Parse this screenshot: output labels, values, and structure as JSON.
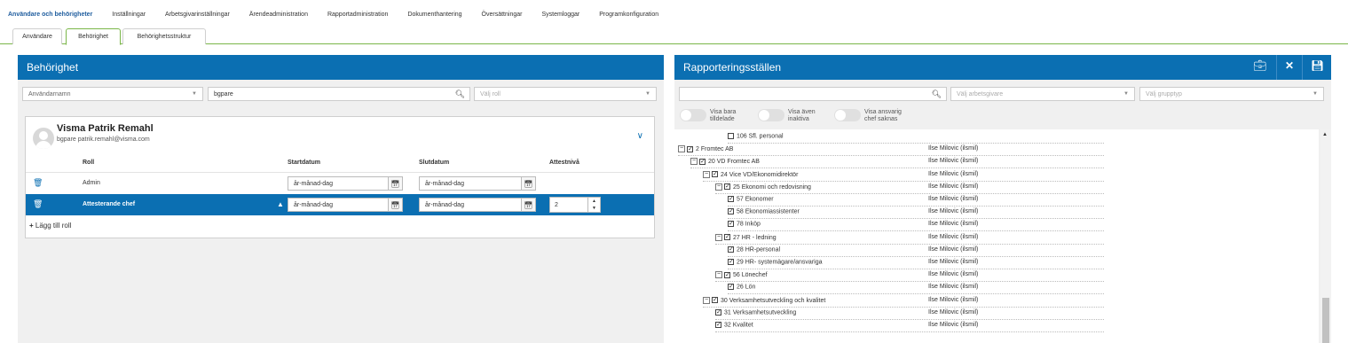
{
  "topnav": [
    "Användare och behörigheter",
    "Inställningar",
    "Arbetsgivarinställningar",
    "Ärendeadministration",
    "Rapportadministration",
    "Dokumenthantering",
    "Översättningar",
    "Systemloggar",
    "Programkonfiguration"
  ],
  "subtabs": [
    "Användare",
    "Behörighet",
    "Behörighetsstruktur"
  ],
  "left": {
    "title": "Behörighet",
    "user_field": "Användarnamn",
    "search_value": "bgpare",
    "role_placeholder": "Välj roll",
    "user": {
      "name": "Visma Patrik Remahl",
      "sub": "bgpare  patrik.remahl@visma.com"
    },
    "columns": {
      "role": "Roll",
      "start": "Startdatum",
      "end": "Slutdatum",
      "level": "Attestnivå"
    },
    "rows": [
      {
        "role": "Admin",
        "start": "år-månad-dag",
        "end": "år-månad-dag"
      },
      {
        "role": "Attesterande chef",
        "start": "år-månad-dag",
        "end": "år-månad-dag",
        "level": "2"
      }
    ],
    "add_role": "Lägg till roll"
  },
  "right": {
    "title": "Rapporteringsställen",
    "employer_placeholder": "Välj arbetsgivare",
    "grouptype_placeholder": "Välj grupptyp",
    "toggles": [
      "Visa bara\ntilldelade",
      "Visa även\ninaktiva",
      "Visa ansvarig\nchef saknas"
    ],
    "tree": [
      {
        "label": "106 Sfl. personal",
        "chef": "",
        "expand": ""
      },
      {
        "label": "2 Fromtec AB",
        "chef": "Ilse Milovic (ilsmil)",
        "expand": "⊟"
      },
      {
        "label": "20 VD Fromtec AB",
        "chef": "Ilse Milovic (ilsmil)",
        "expand": "⊟"
      },
      {
        "label": "24 Vice VD/Ekonomidirektör",
        "chef": "Ilse Milovic (ilsmil)",
        "expand": "⊟"
      },
      {
        "label": "25 Ekonomi och redovisning",
        "chef": "Ilse Milovic (ilsmil)",
        "expand": "⊟"
      },
      {
        "label": "57 Ekonomer",
        "chef": "Ilse Milovic (ilsmil)",
        "expand": ""
      },
      {
        "label": "58 Ekonomiassistenter",
        "chef": "Ilse Milovic (ilsmil)",
        "expand": ""
      },
      {
        "label": "78 Inköp",
        "chef": "Ilse Milovic (ilsmil)",
        "expand": ""
      },
      {
        "label": "27 HR - ledning",
        "chef": "Ilse Milovic (ilsmil)",
        "expand": "⊟"
      },
      {
        "label": "28 HR-personal",
        "chef": "Ilse Milovic (ilsmil)",
        "expand": ""
      },
      {
        "label": "29 HR- systemägare/ansvariga",
        "chef": "Ilse Milovic (ilsmil)",
        "expand": ""
      },
      {
        "label": "56 Lönechef",
        "chef": "Ilse Milovic (ilsmil)",
        "expand": "⊟"
      },
      {
        "label": "26 Lön",
        "chef": "Ilse Milovic (ilsmil)",
        "expand": ""
      },
      {
        "label": "30 Verksamhetsutveckling och kvalitet",
        "chef": "Ilse Milovic (ilsmil)",
        "expand": "⊟"
      },
      {
        "label": "31 Verksamhetsutveckling",
        "chef": "Ilse Milovic (ilsmil)",
        "expand": ""
      },
      {
        "label": "32 Kvalitet",
        "chef": "Ilse Milovic (ilsmil)",
        "expand": ""
      }
    ]
  }
}
